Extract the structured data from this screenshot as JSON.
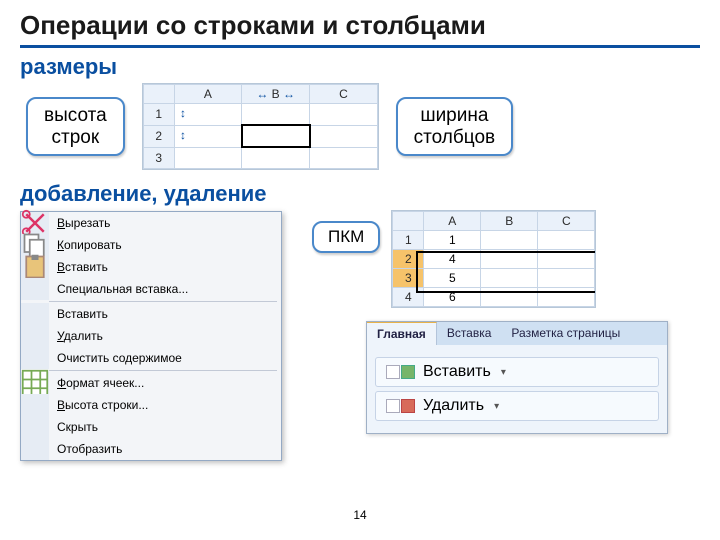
{
  "title": "Операции со строками и столбцами",
  "sections": {
    "sizes": "размеры",
    "add_delete": "добавление, удаление"
  },
  "callouts": {
    "row_height": "высота\nстрок",
    "col_width": "ширина\nстолбцов",
    "rmb": "ПКМ"
  },
  "grid1": {
    "cols": [
      "A",
      "B",
      "C"
    ],
    "rows": [
      "1",
      "2",
      "3"
    ]
  },
  "grid2": {
    "cols": [
      "A",
      "B",
      "C"
    ],
    "rows": [
      "1",
      "2",
      "3",
      "4"
    ],
    "data": [
      [
        "1"
      ],
      [
        "4"
      ],
      [
        "5"
      ],
      [
        "6"
      ]
    ],
    "selected_rows": [
      2,
      3
    ]
  },
  "menu": [
    {
      "u": "В",
      "r": "ырезать"
    },
    {
      "u": "К",
      "r": "опировать"
    },
    {
      "u": "В",
      "r": "ставить"
    },
    {
      "u": "",
      "r": "Специальная вставка..."
    },
    {
      "u": "",
      "r": "Вставить"
    },
    {
      "u": "У",
      "r": "далить"
    },
    {
      "u": "",
      "r": "Очистить содержимое"
    },
    {
      "u": "Ф",
      "r": "ормат ячеек..."
    },
    {
      "u": "В",
      "r": "ысота строки..."
    },
    {
      "u": "",
      "r": "Скрыть"
    },
    {
      "u": "",
      "r": "Отобразить"
    }
  ],
  "ribbon": {
    "tabs": [
      "Главная",
      "Вставка",
      "Разметка страницы"
    ],
    "insert": "Вставить",
    "delete": "Удалить"
  },
  "page": "14"
}
